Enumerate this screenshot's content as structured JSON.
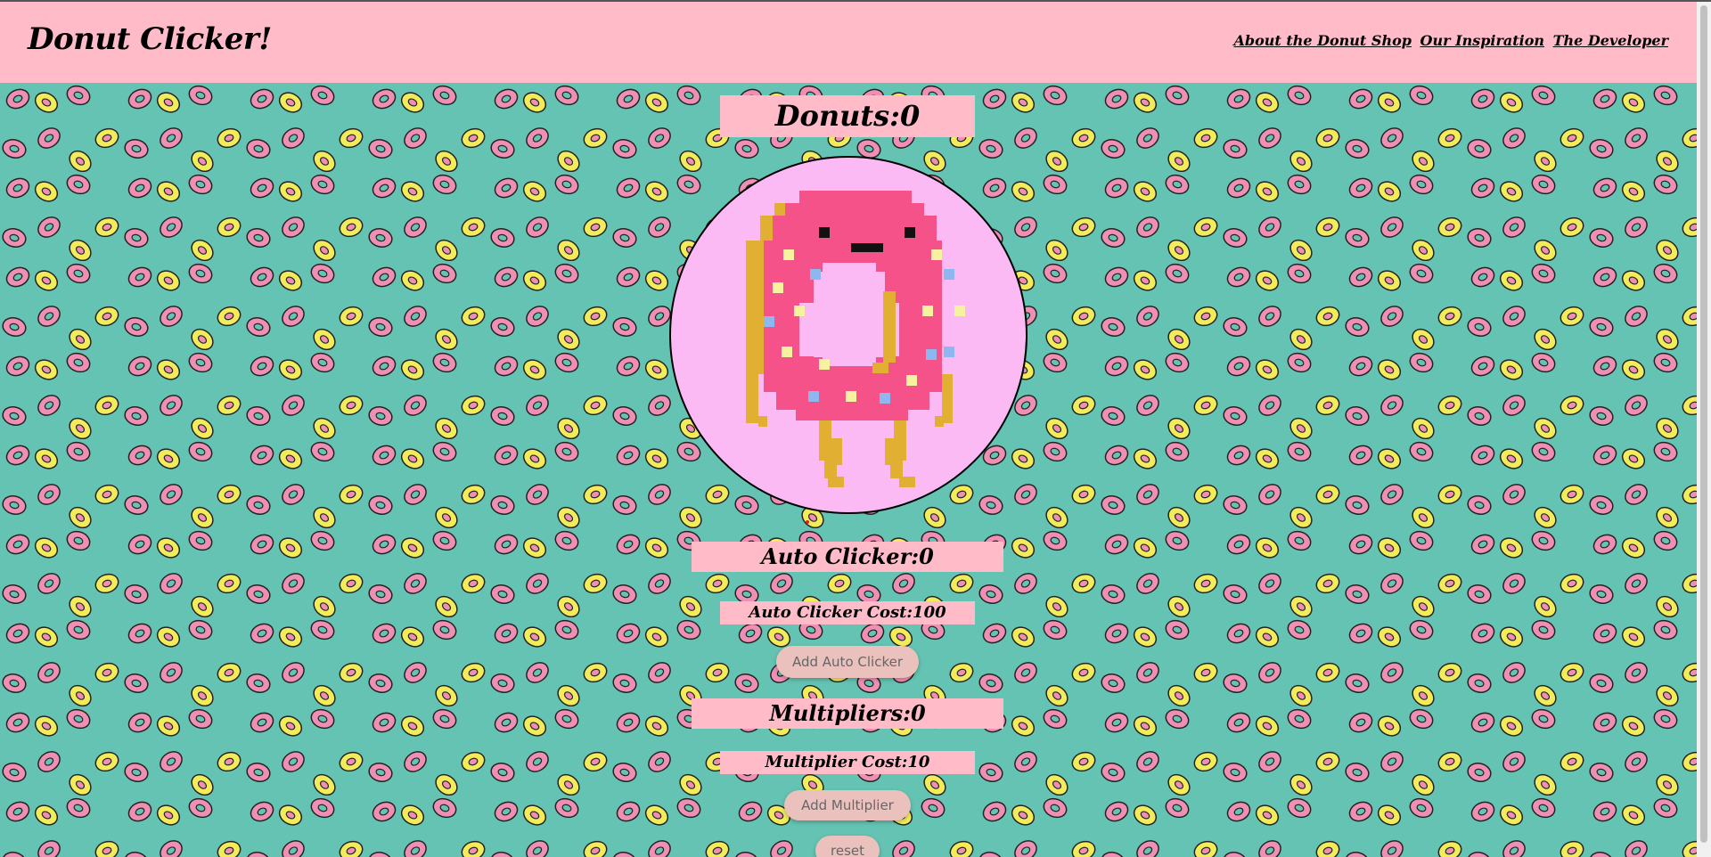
{
  "header": {
    "title": "Donut Clicker!",
    "nav": [
      {
        "label": "About the Donut Shop"
      },
      {
        "label": "Our Inspiration"
      },
      {
        "label": "The Developer"
      }
    ]
  },
  "stats": {
    "donuts": "Donuts:0",
    "auto_clickers": "Auto Clicker:0",
    "auto_clicker_cost": "Auto Clicker Cost:100",
    "multipliers": "Multipliers:0",
    "multiplier_cost": "Multiplier Cost:10"
  },
  "buttons": {
    "add_auto_clicker": "Add Auto Clicker",
    "add_multiplier": "Add Multiplier",
    "reset": "reset"
  },
  "colors": {
    "background_teal": "#64c3b2",
    "header_pink": "#ffbcc8",
    "donut_frosting": "#f5528a",
    "donut_dough": "#e1b033",
    "button": "#ebc1be"
  },
  "icons": {
    "clicker": "pixel-donut-character-icon",
    "pattern": "donut-pattern"
  }
}
